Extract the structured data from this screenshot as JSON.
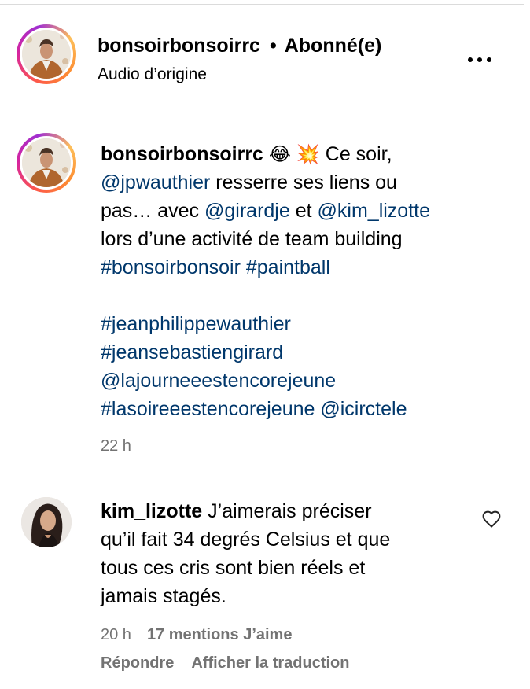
{
  "post_header": {
    "username": "bonsoirbonsoirrc",
    "separator": "•",
    "follow_status": "Abonné(e)",
    "audio_label": "Audio d’origine"
  },
  "caption": {
    "username": "bonsoirbonsoirrc",
    "emoji_1": "😂",
    "emoji_2": "💥",
    "lines": [
      {
        "segments": [
          {
            "t": " Ce soir,",
            "link": false
          }
        ]
      },
      {
        "segments": [
          {
            "t": "@jpwauthier",
            "link": true
          },
          {
            "t": " resserre ses liens ou",
            "link": false
          }
        ]
      },
      {
        "segments": [
          {
            "t": "pas… avec ",
            "link": false
          },
          {
            "t": "@girardje",
            "link": true
          },
          {
            "t": " et ",
            "link": false
          },
          {
            "t": "@kim_lizotte",
            "link": true
          }
        ]
      },
      {
        "segments": [
          {
            "t": "lors d’une activité de team building",
            "link": false
          }
        ]
      },
      {
        "segments": [
          {
            "t": "#bonsoirbonsoir",
            "link": true
          },
          {
            "t": " ",
            "link": false
          },
          {
            "t": "#paintball",
            "link": true
          }
        ]
      },
      {
        "segments": []
      },
      {
        "segments": [
          {
            "t": "#jeanphilippewauthier",
            "link": true
          }
        ]
      },
      {
        "segments": [
          {
            "t": "#jeansebastiengirard",
            "link": true
          }
        ]
      },
      {
        "segments": [
          {
            "t": "@lajourneeestencorejeune",
            "link": true
          }
        ]
      },
      {
        "segments": [
          {
            "t": "#lasoireeestencorejeune",
            "link": true
          },
          {
            "t": " ",
            "link": false
          },
          {
            "t": "@icirctele",
            "link": true
          }
        ]
      }
    ],
    "time": "22 h"
  },
  "comment": {
    "username": "kim_lizotte",
    "lines": [
      " J’aimerais préciser",
      "qu’il fait 34 degrés Celsius et que",
      "tous ces cris sont bien réels et",
      "jamais stagés."
    ],
    "time": "20 h",
    "likes": "17 mentions J’aime",
    "reply_label": "Répondre",
    "translate_label": "Afficher la traduction",
    "like_icon": "heart-outline-icon"
  },
  "colors": {
    "link": "#00376b",
    "secondary_text": "#737373",
    "divider": "#dbdbdb"
  }
}
